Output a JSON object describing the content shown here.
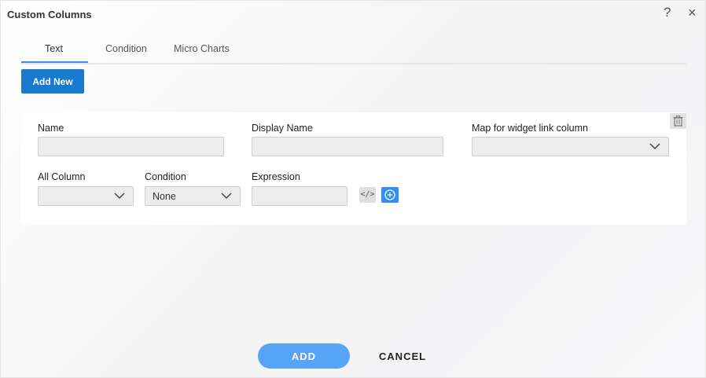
{
  "dialog": {
    "title": "Custom Columns",
    "help_icon": "?",
    "close_icon": "×"
  },
  "tabs": [
    {
      "label": "Text",
      "active": true
    },
    {
      "label": "Condition",
      "active": false
    },
    {
      "label": "Micro Charts",
      "active": false
    }
  ],
  "toolbar": {
    "add_new_label": "Add New"
  },
  "row": {
    "name": {
      "label": "Name",
      "value": ""
    },
    "display_name": {
      "label": "Display Name",
      "value": ""
    },
    "map_widget_link": {
      "label": "Map for widget link column",
      "value": ""
    },
    "all_column": {
      "label": "All Column",
      "value": ""
    },
    "condition": {
      "label": "Condition",
      "value": "None"
    },
    "expression": {
      "label": "Expression",
      "value": ""
    },
    "code_icon": "</>"
  },
  "footer": {
    "add_label": "ADD",
    "cancel_label": "CANCEL"
  },
  "colors": {
    "primary": "#1979cf",
    "add_button": "#56a4f7",
    "plus_button": "#2f8ff0",
    "tab_underline": "#3d8fe0"
  }
}
